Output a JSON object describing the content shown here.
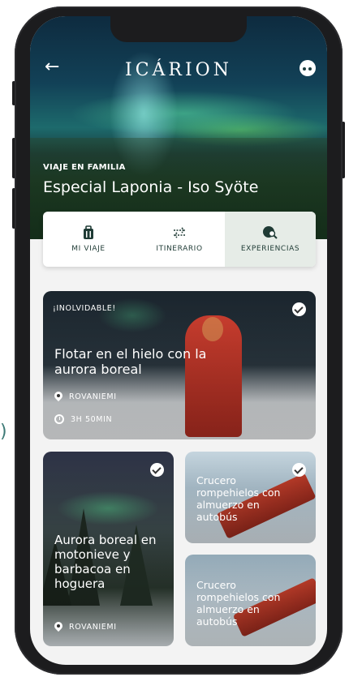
{
  "app": {
    "logo": "ICÁRION"
  },
  "header": {
    "eyebrow": "VIAJE EN FAMILIA",
    "title": "Especial Laponia - Iso Syöte"
  },
  "tabs": [
    {
      "label": "MI VIAJE",
      "icon": "suitcase-icon",
      "active": false
    },
    {
      "label": "ITINERARIO",
      "icon": "swap-arrows-icon",
      "active": false
    },
    {
      "label": "EXPERIENCIAS",
      "icon": "globe-search-icon",
      "active": true
    }
  ],
  "cards": [
    {
      "badge": "¡INOLVIDABLE!",
      "title": "Flotar en el hielo con la aurora boreal",
      "location": "ROVANIEMI",
      "duration": "3H 50MIN",
      "checked": true
    },
    {
      "title": "Aurora boreal en motonieve y barbacoa en hoguera",
      "location": "ROVANIEMI",
      "checked": true
    },
    {
      "title": "Crucero rompehielos con almuerzo en autobús",
      "checked": true
    },
    {
      "title": "Crucero rompehielos con almuerzo en autobús",
      "checked": false
    }
  ],
  "colors": {
    "accent": "#1f3b35",
    "active_tab": "#e6ece7"
  },
  "edge_text": ")"
}
